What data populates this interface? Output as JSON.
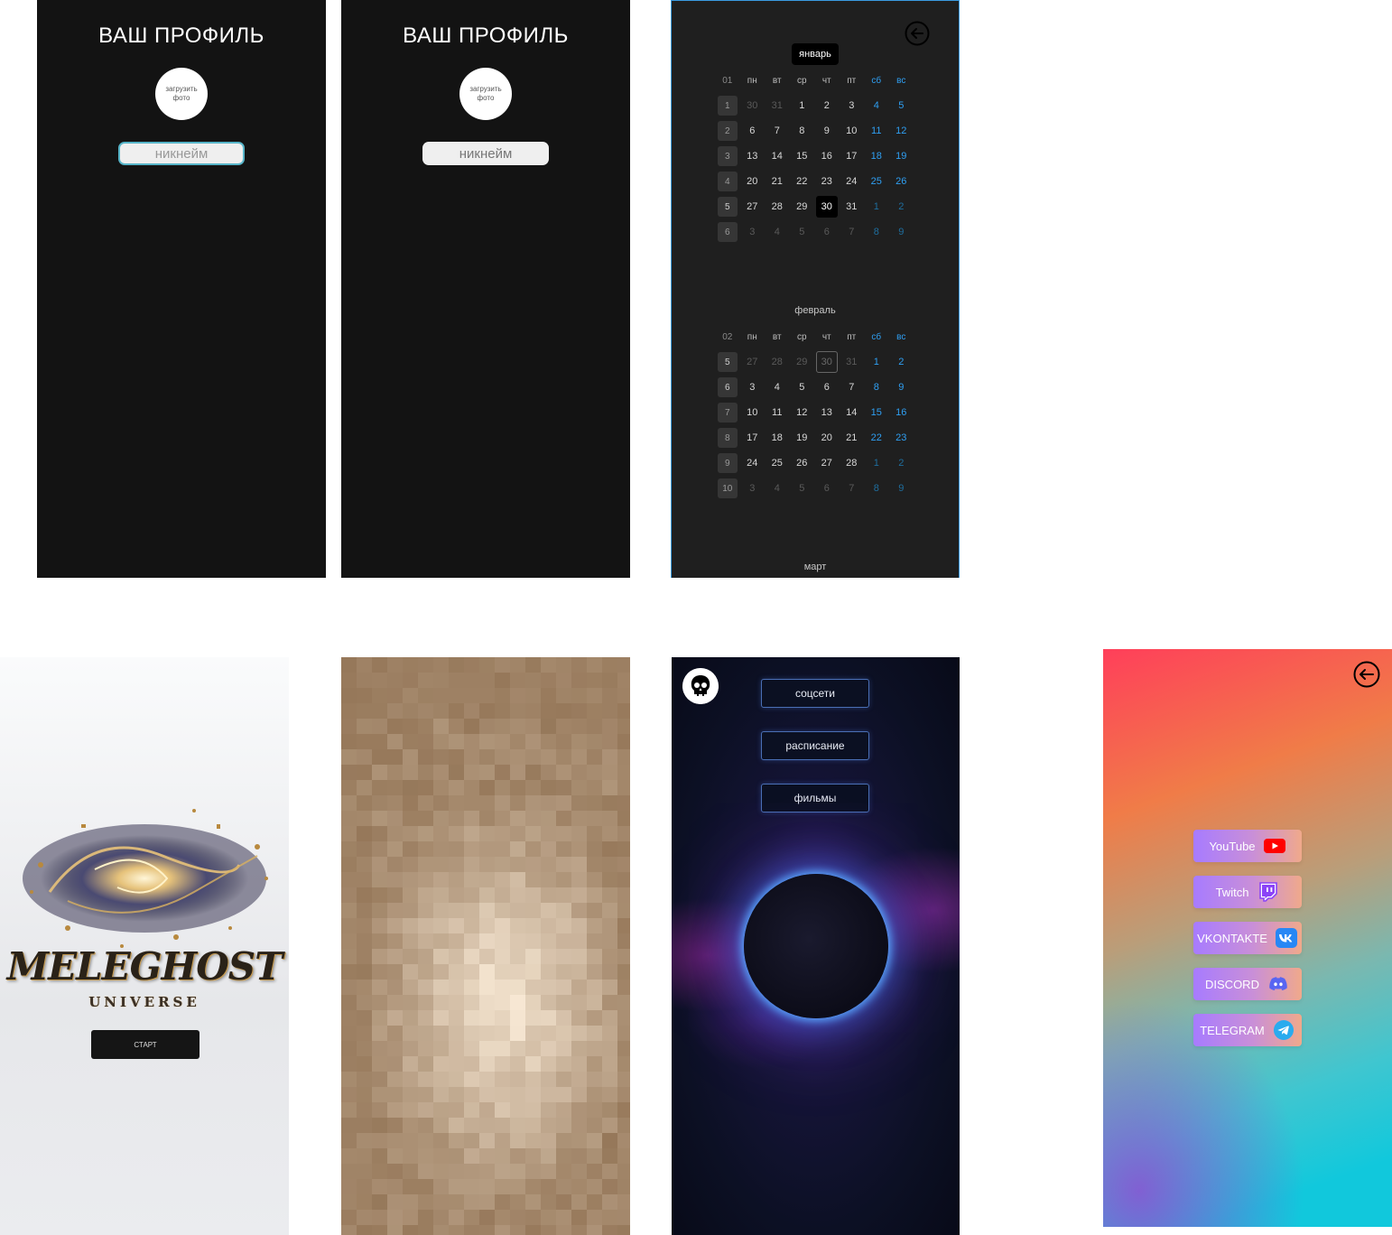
{
  "profile_a": {
    "title": "ВАШ ПРОФИЛЬ",
    "upload_photo": "загрузить фото",
    "nickname_placeholder": "никнейм"
  },
  "profile_b": {
    "title": "ВАШ ПРОФИЛЬ",
    "upload_photo": "загрузить фото",
    "nickname_value": "никнейм"
  },
  "calendar": {
    "january": {
      "label": "январь",
      "month_num": "01",
      "weekdays": [
        "пн",
        "вт",
        "ср",
        "чт",
        "пт",
        "сб",
        "вс"
      ],
      "weeks": [
        {
          "n": "1",
          "days": [
            "30",
            "31",
            "1",
            "2",
            "3",
            "4",
            "5"
          ]
        },
        {
          "n": "2",
          "days": [
            "6",
            "7",
            "8",
            "9",
            "10",
            "11",
            "12"
          ]
        },
        {
          "n": "3",
          "days": [
            "13",
            "14",
            "15",
            "16",
            "17",
            "18",
            "19"
          ]
        },
        {
          "n": "4",
          "days": [
            "20",
            "21",
            "22",
            "23",
            "24",
            "25",
            "26"
          ]
        },
        {
          "n": "5",
          "days": [
            "27",
            "28",
            "29",
            "30",
            "31",
            "1",
            "2"
          ]
        },
        {
          "n": "6",
          "days": [
            "3",
            "4",
            "5",
            "6",
            "7",
            "8",
            "9"
          ]
        }
      ],
      "today": "30"
    },
    "february": {
      "label": "февраль",
      "month_num": "02",
      "weekdays": [
        "пн",
        "вт",
        "ср",
        "чт",
        "пт",
        "сб",
        "вс"
      ],
      "weeks": [
        {
          "n": "5",
          "days": [
            "27",
            "28",
            "29",
            "30",
            "31",
            "1",
            "2"
          ]
        },
        {
          "n": "6",
          "days": [
            "3",
            "4",
            "5",
            "6",
            "7",
            "8",
            "9"
          ]
        },
        {
          "n": "7",
          "days": [
            "10",
            "11",
            "12",
            "13",
            "14",
            "15",
            "16"
          ]
        },
        {
          "n": "8",
          "days": [
            "17",
            "18",
            "19",
            "20",
            "21",
            "22",
            "23"
          ]
        },
        {
          "n": "9",
          "days": [
            "24",
            "25",
            "26",
            "27",
            "28",
            "1",
            "2"
          ]
        },
        {
          "n": "10",
          "days": [
            "3",
            "4",
            "5",
            "6",
            "7",
            "8",
            "9"
          ]
        }
      ]
    },
    "march": {
      "label": "март"
    },
    "colors": {
      "weekend": "#2f9ff2",
      "accent_border": "#3a9ae0"
    }
  },
  "start_screen": {
    "logo": "MELEGHOST",
    "subtitle": "UNIVERSE",
    "start_label": "СТАРТ"
  },
  "menu_screen": {
    "buttons": [
      "соцсети",
      "расписание",
      "фильмы"
    ],
    "icon": "skull-icon"
  },
  "social_screen": {
    "links": [
      {
        "label": "YouTube",
        "icon": "youtube-icon"
      },
      {
        "label": "Twitch",
        "icon": "twitch-icon"
      },
      {
        "label": "VKONTAKTE",
        "icon": "vk-icon"
      },
      {
        "label": "DISCORD",
        "icon": "discord-icon"
      },
      {
        "label": "TELEGRAM",
        "icon": "telegram-icon"
      }
    ]
  }
}
